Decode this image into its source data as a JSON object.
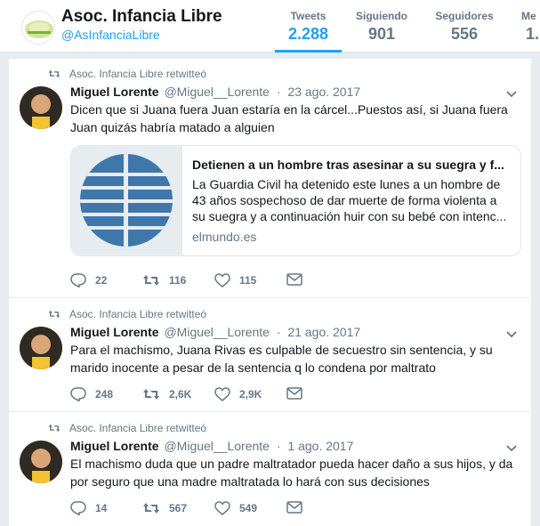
{
  "profile": {
    "name": "Asoc. Infancia Libre",
    "handle": "@AsInfanciaLibre"
  },
  "stats": [
    {
      "label": "Tweets",
      "value": "2.288"
    },
    {
      "label": "Siguiendo",
      "value": "901"
    },
    {
      "label": "Seguidores",
      "value": "556"
    },
    {
      "label": "Me",
      "value": "1."
    }
  ],
  "tweets": [
    {
      "retweet_label": "Asoc. Infancia Libre retwitteó",
      "author": "Miguel Lorente",
      "handle": "@Miguel__Lorente",
      "separator": "·",
      "date": "23 ago. 2017",
      "text": "Dicen que si Juana fuera Juan estaría en la cárcel...Puestos así, si Juana fuera Juan quizás habría matado a alguien",
      "card": {
        "title": "Detienen a un hombre tras asesinar a su suegra y f...",
        "description": "La Guardia Civil ha detenido este lunes a un hombre de 43 años sospechoso de dar muerte de forma violenta a su suegra y a continuación huir con su bebé con intenc...",
        "domain": "elmundo.es"
      },
      "replies": "22",
      "retweets": "116",
      "likes": "115"
    },
    {
      "retweet_label": "Asoc. Infancia Libre retwitteó",
      "author": "Miguel Lorente",
      "handle": "@Miguel__Lorente",
      "separator": "·",
      "date": "21 ago. 2017",
      "text": "Para el machismo, Juana Rivas es culpable de secuestro sin sentencia, y su marido inocente a pesar de la sentencia q lo condena por maltrato",
      "replies": "248",
      "retweets": "2,6K",
      "likes": "2,9K"
    },
    {
      "retweet_label": "Asoc. Infancia Libre retwitteó",
      "author": "Miguel Lorente",
      "handle": "@Miguel__Lorente",
      "separator": "·",
      "date": "1 ago. 2017",
      "text": "El machismo duda que un padre maltratador pueda hacer daño a sus hijos, y da por seguro que una madre maltratada lo hará con sus decisiones",
      "replies": "14",
      "retweets": "567",
      "likes": "549"
    }
  ],
  "colors": {
    "accent": "#1da1f2",
    "muted": "#657786",
    "background": "#e6ecf0"
  }
}
